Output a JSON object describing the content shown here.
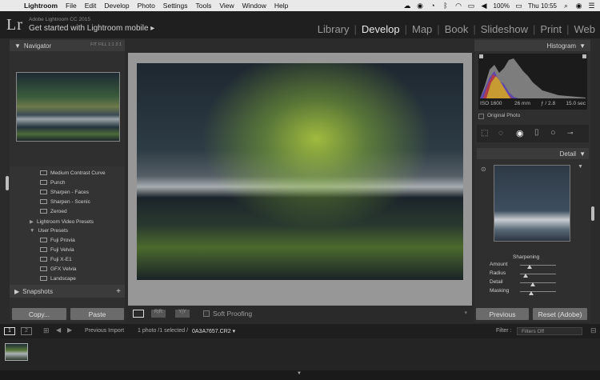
{
  "menubar": {
    "app": "Lightroom",
    "items": [
      "File",
      "Edit",
      "Develop",
      "Photo",
      "Settings",
      "Tools",
      "View",
      "Window",
      "Help"
    ],
    "battery": "100%",
    "clock": "Thu 10:55"
  },
  "identity": {
    "logo": "Lr",
    "version": "Adobe Lightroom CC 2015",
    "mobile": "Get started with Lightroom mobile  ▸"
  },
  "modules": [
    "Library",
    "Develop",
    "Map",
    "Book",
    "Slideshow",
    "Print",
    "Web"
  ],
  "left": {
    "navigator_title": "Navigator",
    "zoom_levels": "FIT  FILL  1:1  2:1",
    "presets": [
      {
        "label": "Medium Contrast Curve",
        "type": "item"
      },
      {
        "label": "Punch",
        "type": "item"
      },
      {
        "label": "Sharpen - Faces",
        "type": "item"
      },
      {
        "label": "Sharpen - Scenic",
        "type": "item"
      },
      {
        "label": "Zeroed",
        "type": "item"
      },
      {
        "label": "Lightroom Video Presets",
        "type": "folder-closed"
      },
      {
        "label": "User Presets",
        "type": "folder-open"
      },
      {
        "label": "Fuji Provia",
        "type": "item"
      },
      {
        "label": "Fuji Velvia",
        "type": "item"
      },
      {
        "label": "Fuji X-E1",
        "type": "item"
      },
      {
        "label": "GFX Velvia",
        "type": "item"
      },
      {
        "label": "Landscape",
        "type": "item"
      }
    ],
    "snapshots_title": "Snapshots",
    "copy_label": "Copy...",
    "paste_label": "Paste"
  },
  "toolbar": {
    "soft_proofing": "Soft Proofing"
  },
  "right": {
    "histogram_title": "Histogram",
    "iso": "ISO 1600",
    "focal": "26 mm",
    "aperture": "ƒ / 2.8",
    "shutter": "15.0 sec",
    "original_photo": "Original Photo",
    "detail_title": "Detail",
    "sharpening_title": "Sharpening",
    "sliders": [
      {
        "label": "Amount",
        "value": "40",
        "fraction": 0.27
      },
      {
        "label": "Radius",
        "value": "0.8",
        "fraction": 0.15
      },
      {
        "label": "Detail",
        "value": "35",
        "fraction": 0.35
      },
      {
        "label": "Masking",
        "value": "30",
        "fraction": 0.3
      }
    ],
    "previous_label": "Previous",
    "reset_label": "Reset (Adobe)"
  },
  "filmstrip": {
    "page1": "1",
    "page2": "2",
    "source": "Previous Import",
    "count": "1 photo /1 selected /",
    "filename": "0A3A7657.CR2 ▾",
    "filter_label": "Filter :",
    "filter_value": "Filters Off"
  }
}
